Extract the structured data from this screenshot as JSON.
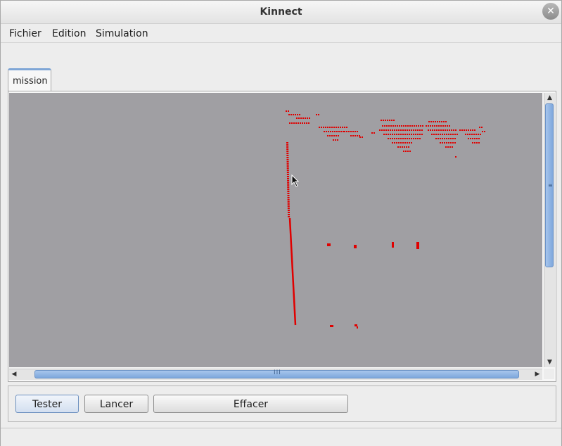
{
  "window": {
    "title": "Kinnect",
    "close_icon": "close-icon"
  },
  "menubar": {
    "items": [
      "Fichier",
      "Edition",
      "Simulation"
    ]
  },
  "tabs": [
    {
      "label": "mission",
      "selected": true
    }
  ],
  "canvas": {
    "background": "#a09fa3",
    "point_color": "#e00000"
  },
  "scrollbars": {
    "vertical_grip": "≡",
    "horizontal_grip": "III",
    "accent": "#8fb3e6"
  },
  "buttons": {
    "tester": "Tester",
    "lancer": "Lancer",
    "effacer": "Effacer"
  },
  "icons": {
    "scroll_up": "chevron-up-icon",
    "scroll_down": "chevron-down-icon",
    "scroll_left": "chevron-left-icon",
    "scroll_right": "chevron-right-icon",
    "cursor": "mouse-pointer-icon"
  }
}
